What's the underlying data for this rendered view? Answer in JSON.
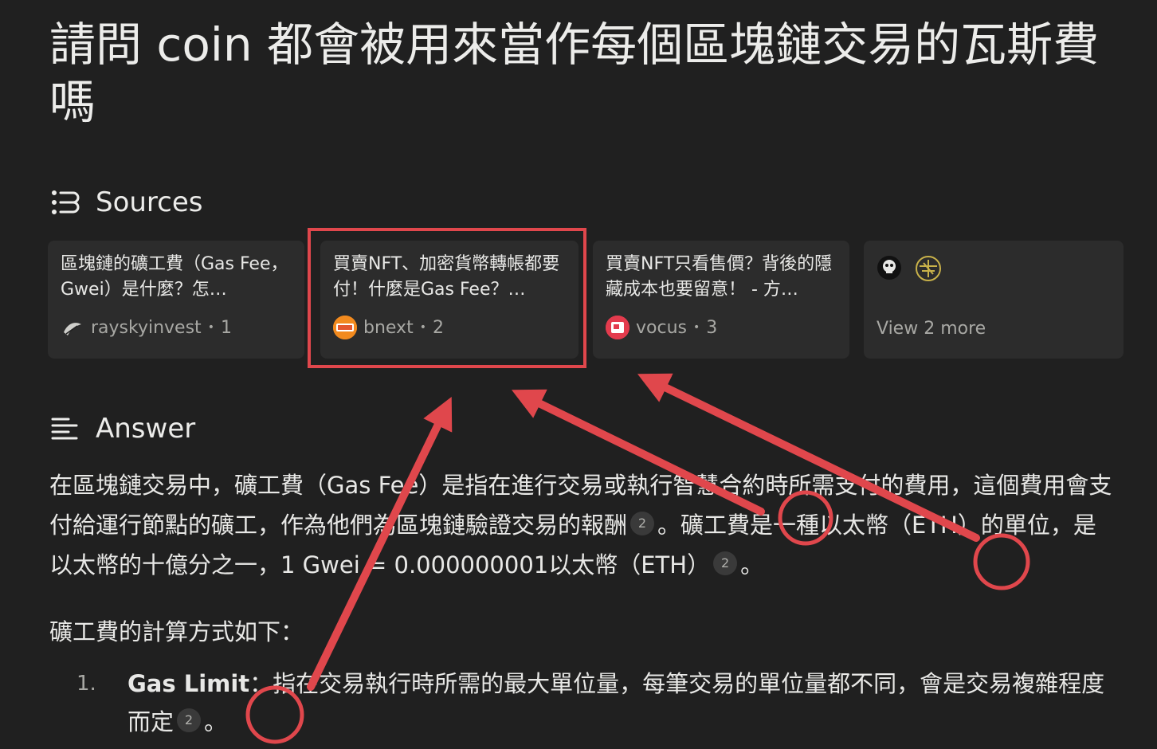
{
  "question": "請問 coin 都會被用來當作每個區塊鏈交易的瓦斯費嗎",
  "sources_header": "Sources",
  "answer_header": "Answer",
  "sources": [
    {
      "title": "區塊鏈的礦工費（Gas Fee，Gwei）是什麼？怎…",
      "site": "rayskyinvest",
      "index": "1"
    },
    {
      "title": "買賣NFT、加密貨幣轉帳都要付！什麼是Gas Fee？…",
      "site": "bnext",
      "index": "2"
    },
    {
      "title": "買賣NFT只看售價？背後的隱藏成本也要留意！ - 方…",
      "site": "vocus",
      "index": "3"
    }
  ],
  "view_more": "View 2 more",
  "answer": {
    "p1_a": "在區塊鏈交易中，礦工費（Gas Fee）是指在進行交易或執行智慧合約時所需支付的費用，這個費用會支付給運行節點的礦工，作為他們為區塊鏈驗證交易的報酬",
    "cite1": "2",
    "p1_b": "。礦工費是一種以太幣（ETH）的單位，是以太幣的十億分之一，1 Gwei = 0.000000001以太幣（ETH）",
    "cite2": "2",
    "p1_c": "。",
    "p2": "礦工費的計算方式如下：",
    "list": [
      {
        "num": "1.",
        "term": "Gas Limit",
        "text": "：指在交易執行時所需的最大單位量，每筆交易的單位量都不同，會是交易複雜程度而定",
        "cite": "2",
        "end": "。"
      }
    ]
  },
  "colors": {
    "background": "#202020",
    "card": "#2c2c2c",
    "annotation_red": "#e0474c",
    "muted_text": "#a8a8a4"
  }
}
